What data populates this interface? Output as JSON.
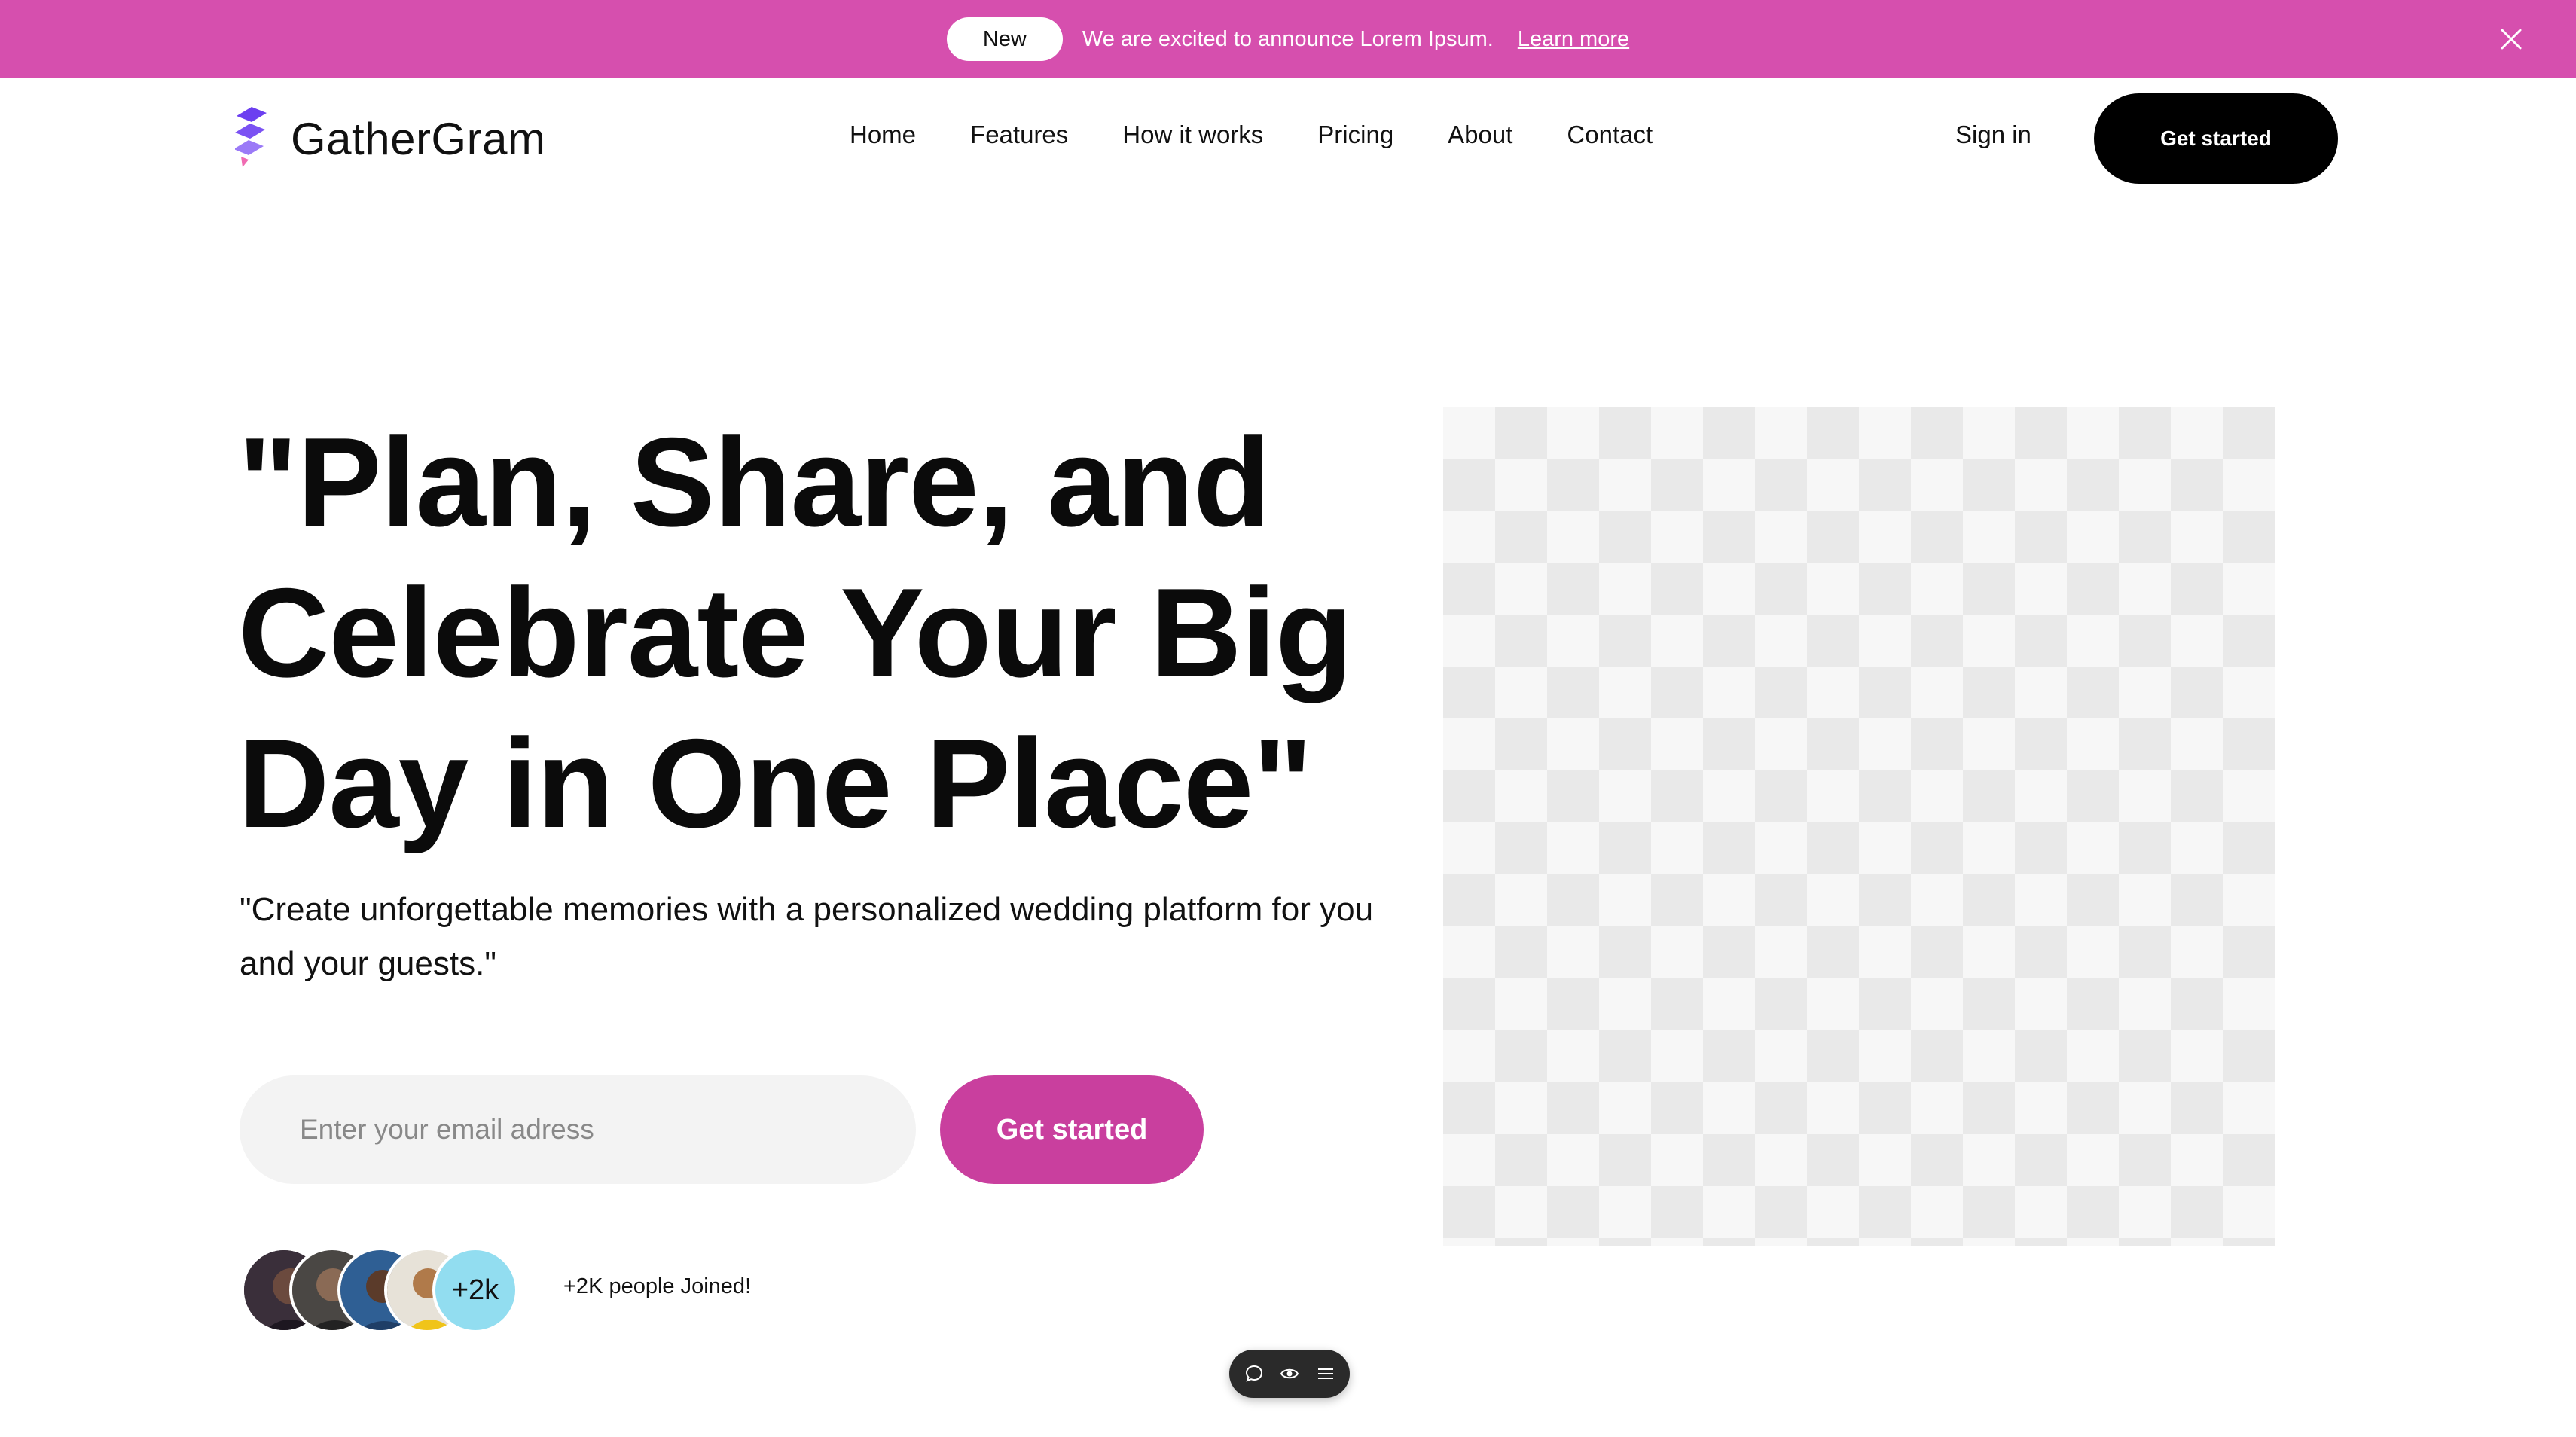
{
  "announcement": {
    "badge": "New",
    "text": "We are excited to announce Lorem Ipsum.",
    "link": "Learn more",
    "background": "#d64fae"
  },
  "nav": {
    "brand": "GatherGram",
    "links": [
      "Home",
      "Features",
      "How it works",
      "Pricing",
      "About",
      "Contact"
    ],
    "sign_in": "Sign in",
    "cta": "Get started"
  },
  "hero": {
    "headline": "\"Plan, Share, and Celebrate Your Big Day in One Place\"",
    "subtext": "\"Create unforgettable memories with a personalized wedding platform for you and your guests.\"",
    "email_placeholder": "Enter your email adress",
    "email_value": "",
    "cta": "Get started",
    "cta_color": "#c93f9e",
    "avatar_count_label": "+2k",
    "joined_text": "+2K people Joined!"
  },
  "toolbar": {
    "icons": [
      "comment-icon",
      "eye-icon",
      "menu-lines-icon"
    ]
  }
}
